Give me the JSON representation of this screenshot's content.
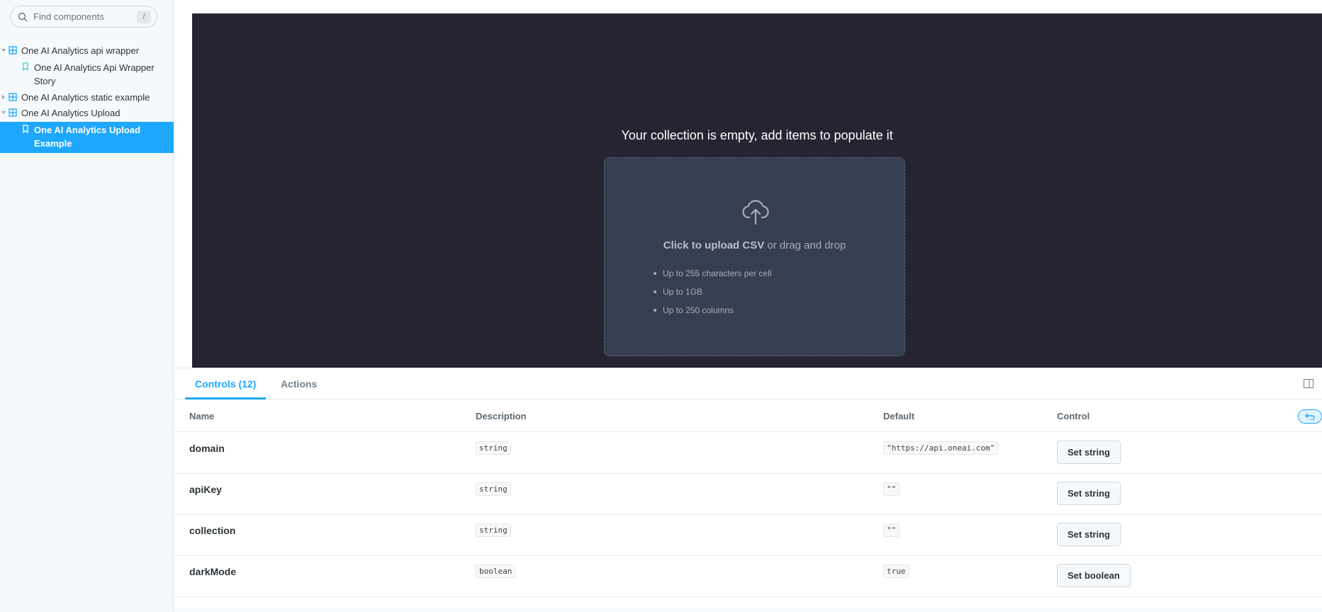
{
  "sidebar": {
    "search_placeholder": "Find components",
    "search_shortcut": "/",
    "tree": [
      {
        "type": "component",
        "label": "One AI Analytics api wrapper",
        "expanded": true
      },
      {
        "type": "story",
        "label": "One AI Analytics Api Wrapper Story",
        "active": false
      },
      {
        "type": "component",
        "label": "One AI Analytics static example",
        "expanded": false
      },
      {
        "type": "component",
        "label": "One AI Analytics Upload",
        "expanded": true
      },
      {
        "type": "story",
        "label": "One AI Analytics Upload Example",
        "active": true
      }
    ]
  },
  "preview": {
    "empty_message": "Your collection is empty, add items to populate it",
    "upload_bold": "Click to upload CSV",
    "upload_rest": " or drag and drop",
    "bullets": [
      "Up to 255 characters per cell",
      "Up to 1GB",
      "Up to 250 columns"
    ]
  },
  "panel": {
    "tabs": [
      "Controls (12)",
      "Actions"
    ],
    "columns": [
      "Name",
      "Description",
      "Default",
      "Control"
    ],
    "rows": [
      {
        "name": "domain",
        "type": "string",
        "default": "\"https://api.oneai.com\"",
        "control": "Set string"
      },
      {
        "name": "apiKey",
        "type": "string",
        "default": "\"\"",
        "control": "Set string"
      },
      {
        "name": "collection",
        "type": "string",
        "default": "\"\"",
        "control": "Set string"
      },
      {
        "name": "darkMode",
        "type": "boolean",
        "default": "true",
        "control": "Set boolean"
      }
    ]
  },
  "colors": {
    "accent": "#1ea7fd",
    "preview_bg": "#262433",
    "dropzone_bg": "#363f51"
  }
}
